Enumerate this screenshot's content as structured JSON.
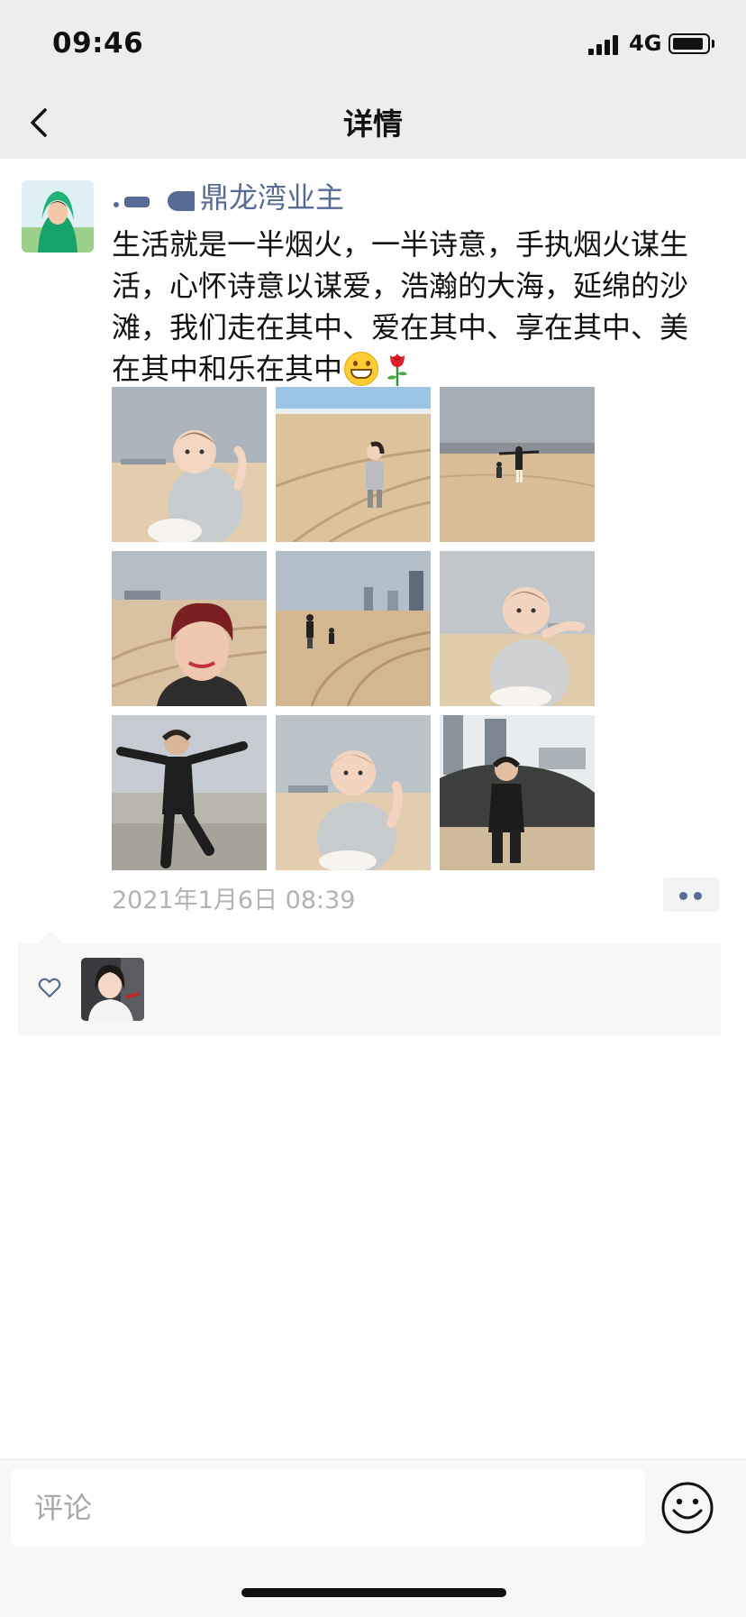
{
  "status_bar": {
    "time": "09:46",
    "network": "4G"
  },
  "nav": {
    "title": "详情"
  },
  "post": {
    "author": "鼎龙湾业主",
    "text": "生活就是一半烟火，一半诗意，手执烟火谋生活，心怀诗意以谋爱，浩瀚的大海，延绵的沙滩，我们走在其中、爱在其中、享在其中、美在其中和乐在其中",
    "emojis": [
      "grinning-face-icon",
      "rose-icon"
    ],
    "photos": [
      "photo-girl-on-beach",
      "photo-girl-walking-on-sand",
      "photo-adult-and-child-on-beach",
      "photo-woman-selfie-on-beach",
      "photo-two-figures-near-buildings",
      "photo-girl-close-up",
      "photo-boy-jumping-on-beach",
      "photo-girl-with-hand-up",
      "photo-boy-by-rocks"
    ],
    "timestamp": "2021年1月6日 08:39"
  },
  "likes": {
    "icon": "heart-icon",
    "count_avatars": 1
  },
  "comment_bar": {
    "placeholder": "评论"
  },
  "colors": {
    "nav_bg": "#ededed",
    "link": "#576b95",
    "timestamp": "#b2b2b2"
  }
}
